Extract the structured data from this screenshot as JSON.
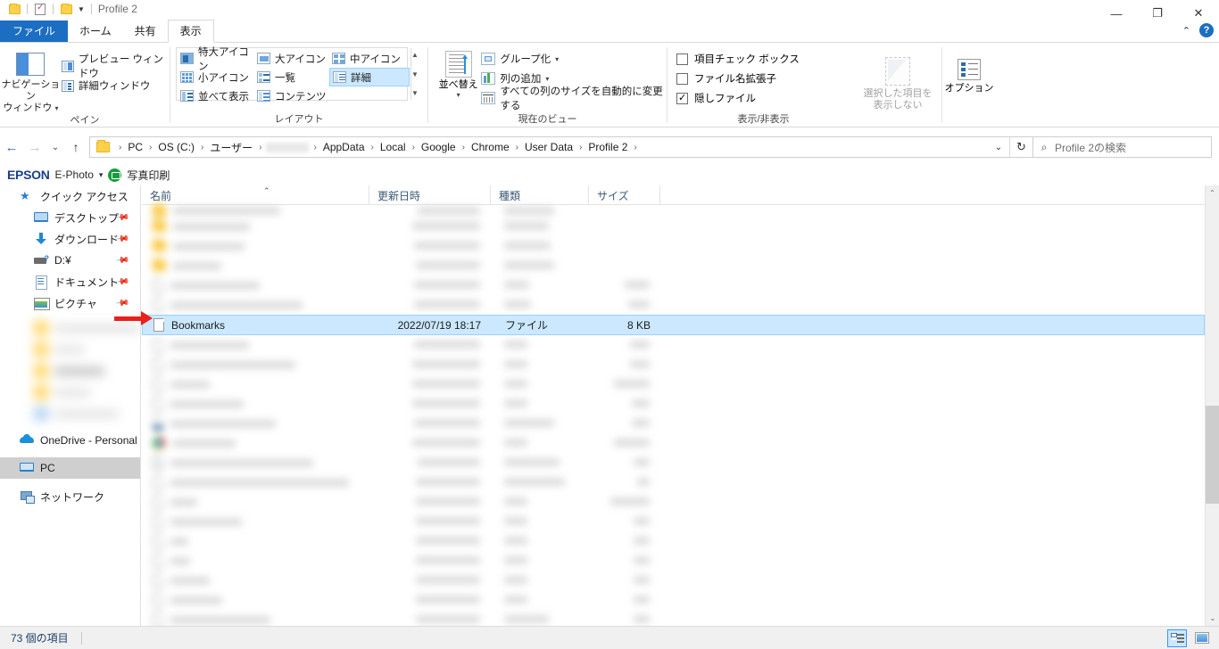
{
  "window": {
    "title": "Profile 2",
    "minimize_label": "—",
    "maximize_label": "❐",
    "close_label": "✕",
    "ribbon_collapse_label": "⌃",
    "help_label": "?"
  },
  "tabs": [
    {
      "id": "file",
      "label": "ファイル"
    },
    {
      "id": "home",
      "label": "ホーム"
    },
    {
      "id": "share",
      "label": "共有"
    },
    {
      "id": "view",
      "label": "表示"
    }
  ],
  "ribbon": {
    "groups": [
      {
        "id": "panes",
        "label": "ペイン",
        "nav_pane": "ナビゲーション\nウィンドウ",
        "nav_pane_line1": "ナビゲーション",
        "nav_pane_line2": "ウィンドウ",
        "preview_pane": "プレビュー ウィンドウ",
        "details_pane": "詳細ウィンドウ"
      },
      {
        "id": "layout",
        "label": "レイアウト",
        "items": [
          {
            "label": "特大アイコン",
            "selected": false
          },
          {
            "label": "大アイコン",
            "selected": false
          },
          {
            "label": "中アイコン",
            "selected": false
          },
          {
            "label": "小アイコン",
            "selected": false
          },
          {
            "label": "一覧",
            "selected": false
          },
          {
            "label": "詳細",
            "selected": true
          },
          {
            "label": "並べて表示",
            "selected": false
          },
          {
            "label": "コンテンツ",
            "selected": false
          }
        ]
      },
      {
        "id": "current_view",
        "label": "現在のビュー",
        "sort_button": "並べ替え",
        "group_by": "グループ化",
        "add_columns": "列の追加",
        "size_all_columns": "すべての列のサイズを自動的に変更する"
      },
      {
        "id": "show_hide",
        "label": "表示/非表示",
        "checkboxes": [
          {
            "label": "項目チェック ボックス",
            "checked": false
          },
          {
            "label": "ファイル名拡張子",
            "checked": false
          },
          {
            "label": "隠しファイル",
            "checked": true
          }
        ],
        "hide_selected_line1": "選択した項目を",
        "hide_selected_line2": "表示しない",
        "options": "オプション"
      }
    ]
  },
  "address": {
    "back_label": "←",
    "forward_label": "→",
    "recent_label": "⌄",
    "up_label": "↑",
    "breadcrumbs": [
      {
        "label": "PC",
        "redacted": false
      },
      {
        "label": "OS (C:)",
        "redacted": false
      },
      {
        "label": "ユーザー",
        "redacted": false
      },
      {
        "label": "",
        "redacted": true
      },
      {
        "label": "AppData",
        "redacted": false
      },
      {
        "label": "Local",
        "redacted": false
      },
      {
        "label": "Google",
        "redacted": false
      },
      {
        "label": "Chrome",
        "redacted": false
      },
      {
        "label": "User Data",
        "redacted": false
      },
      {
        "label": "Profile 2",
        "redacted": false
      }
    ],
    "separator": "›",
    "dropdown_label": "⌄",
    "refresh_label": "↻",
    "search_placeholder": "Profile 2の検索",
    "search_value": ""
  },
  "epson_bar": {
    "logo": "EPSON",
    "app": "E-Photo",
    "caret": "▾",
    "print_label": "写真印刷"
  },
  "sidebar": {
    "items": [
      {
        "id": "quick-access",
        "label": "クイック アクセス",
        "icon": "star-icon",
        "indent": false,
        "pinned": false,
        "selected": false
      },
      {
        "id": "desktop",
        "label": "デスクトップ",
        "icon": "desktop-icon",
        "indent": true,
        "pinned": true,
        "selected": false
      },
      {
        "id": "downloads",
        "label": "ダウンロード",
        "icon": "download-icon",
        "indent": true,
        "pinned": true,
        "selected": false
      },
      {
        "id": "drive-d",
        "label": "D:¥",
        "icon": "drive-icon",
        "indent": true,
        "pinned": true,
        "selected": false
      },
      {
        "id": "documents",
        "label": "ドキュメント",
        "icon": "documents-icon",
        "indent": true,
        "pinned": true,
        "selected": false
      },
      {
        "id": "pictures",
        "label": "ピクチャ",
        "icon": "pictures-icon",
        "indent": true,
        "pinned": true,
        "selected": false
      }
    ],
    "redacted_count": 5,
    "bottom_items": [
      {
        "id": "onedrive",
        "label": "OneDrive - Personal",
        "icon": "cloud-icon",
        "selected": false
      },
      {
        "id": "pc",
        "label": "PC",
        "icon": "pc-icon",
        "selected": true
      },
      {
        "id": "network",
        "label": "ネットワーク",
        "icon": "network-icon",
        "selected": false
      }
    ],
    "pin_glyph": "📌"
  },
  "file_list": {
    "columns": [
      {
        "id": "name",
        "label": "名前",
        "sorted": true,
        "sort_glyph": "⌃"
      },
      {
        "id": "date",
        "label": "更新日時"
      },
      {
        "id": "type",
        "label": "種類"
      },
      {
        "id": "size",
        "label": "サイズ"
      }
    ],
    "rows": [
      {
        "icon": "folder-icon",
        "name": "",
        "date": "",
        "type": "",
        "size": "",
        "redacted": true,
        "selected": false
      },
      {
        "icon": "folder-icon",
        "name": "",
        "date": "",
        "type": "",
        "size": "",
        "redacted": true,
        "selected": false
      },
      {
        "icon": "folder-icon",
        "name": "",
        "date": "",
        "type": "",
        "size": "",
        "redacted": true,
        "selected": false
      },
      {
        "icon": "folder-icon",
        "name": "",
        "date": "",
        "type": "",
        "size": "",
        "redacted": true,
        "selected": false
      },
      {
        "icon": "file-icon",
        "name": "",
        "date": "",
        "type": "",
        "size": "",
        "redacted": true,
        "selected": false
      },
      {
        "icon": "file-icon",
        "name": "",
        "date": "",
        "type": "",
        "size": "",
        "redacted": true,
        "selected": false
      },
      {
        "icon": "file-icon",
        "name": "Bookmarks",
        "date": "2022/07/19 18:17",
        "type": "ファイル",
        "size": "8 KB",
        "redacted": false,
        "selected": true
      },
      {
        "icon": "file-icon",
        "name": "",
        "date": "",
        "type": "",
        "size": "",
        "redacted": true,
        "selected": false
      },
      {
        "icon": "file-icon",
        "name": "",
        "date": "",
        "type": "",
        "size": "",
        "redacted": true,
        "selected": false
      },
      {
        "icon": "file-icon",
        "name": "",
        "date": "",
        "type": "",
        "size": "",
        "redacted": true,
        "selected": false
      },
      {
        "icon": "file-icon",
        "name": "",
        "date": "",
        "type": "",
        "size": "",
        "redacted": true,
        "selected": false
      },
      {
        "icon": "data-file-icon",
        "name": "",
        "date": "",
        "type": "",
        "size": "",
        "redacted": true,
        "selected": false
      },
      {
        "icon": "chrome-icon",
        "name": "",
        "date": "",
        "type": "",
        "size": "",
        "redacted": true,
        "selected": false
      },
      {
        "icon": "script-file-icon",
        "name": "",
        "date": "",
        "type": "",
        "size": "",
        "redacted": true,
        "selected": false
      },
      {
        "icon": "file-icon",
        "name": "",
        "date": "",
        "type": "",
        "size": "",
        "redacted": true,
        "selected": false
      },
      {
        "icon": "file-icon",
        "name": "",
        "date": "",
        "type": "",
        "size": "",
        "redacted": true,
        "selected": false
      },
      {
        "icon": "file-icon",
        "name": "",
        "date": "",
        "type": "",
        "size": "",
        "redacted": true,
        "selected": false
      },
      {
        "icon": "file-icon",
        "name": "",
        "date": "",
        "type": "",
        "size": "",
        "redacted": true,
        "selected": false
      },
      {
        "icon": "file-icon",
        "name": "",
        "date": "",
        "type": "",
        "size": "",
        "redacted": true,
        "selected": false
      },
      {
        "icon": "file-icon",
        "name": "",
        "date": "",
        "type": "",
        "size": "",
        "redacted": true,
        "selected": false
      },
      {
        "icon": "file-icon",
        "name": "",
        "date": "",
        "type": "",
        "size": "",
        "redacted": true,
        "selected": false
      },
      {
        "icon": "file-icon",
        "name": "",
        "date": "",
        "type": "",
        "size": "",
        "redacted": true,
        "selected": false
      }
    ]
  },
  "scrollbar": {
    "up_label": "⌃",
    "down_label": "⌄"
  },
  "status": {
    "item_count": "73 個の項目",
    "view_details_name": "details-view",
    "view_icons_name": "large-icons-view"
  },
  "colors": {
    "accent": "#1b6ec2",
    "selection": "#cce8ff",
    "selection_border": "#99d1ff",
    "annotation_red": "#e8211a",
    "folder_yellow": "#ffd04d",
    "epson_blue": "#1b3f8b",
    "header_text": "#3d5a77"
  }
}
